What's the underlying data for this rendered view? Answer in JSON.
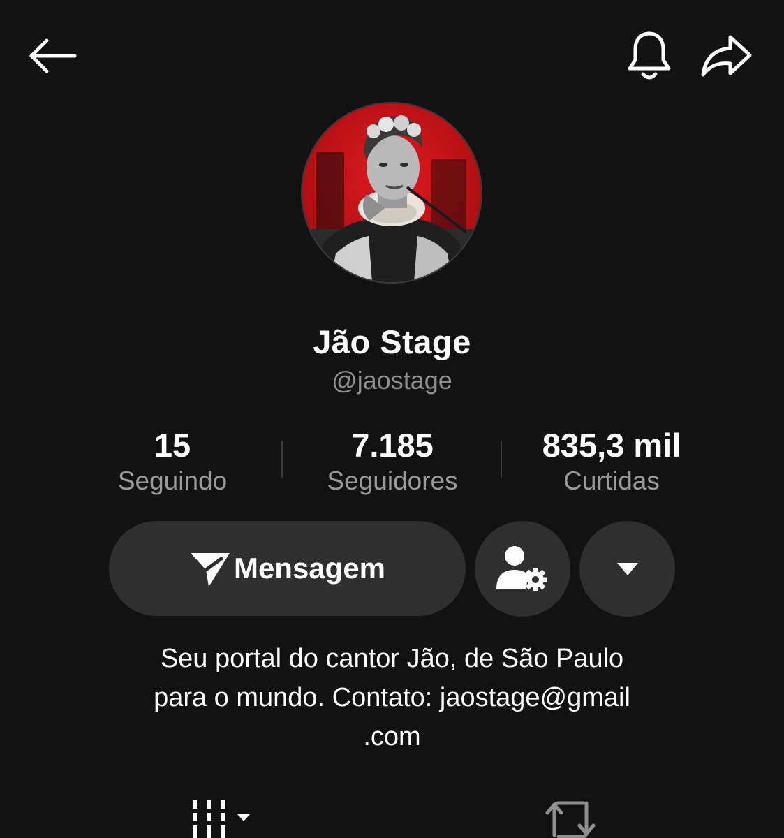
{
  "profile": {
    "name": "Jão Stage",
    "handle": "@jaostage",
    "avatar_colors": {
      "background_red": "#d4121a",
      "dark": "#1e1e1e"
    }
  },
  "stats": [
    {
      "value": "15",
      "label": "Seguindo"
    },
    {
      "value": "7.185",
      "label": "Seguidores"
    },
    {
      "value": "835,3 mil",
      "label": "Curtidas"
    }
  ],
  "actions": {
    "message_label": "Mensagem",
    "message_icon": "send-icon",
    "friend_icon": "user-settings-icon",
    "more_icon": "caret-down-icon",
    "button_bg": "#2f2f2f"
  },
  "bio": {
    "line1": "Seu portal do cantor Jão, de São Paulo",
    "line2": "para o mundo. Contato: jaostage@gmail",
    "line3": ".com"
  },
  "topbar": {
    "back_icon": "arrow-left-icon",
    "bell_icon": "bell-icon",
    "share_icon": "share-icon"
  },
  "tabs": {
    "videos_icon": "grid-icon",
    "reposts_icon": "repost-icon"
  },
  "colors": {
    "background": "#121212",
    "muted_text": "#8f8f8f"
  }
}
